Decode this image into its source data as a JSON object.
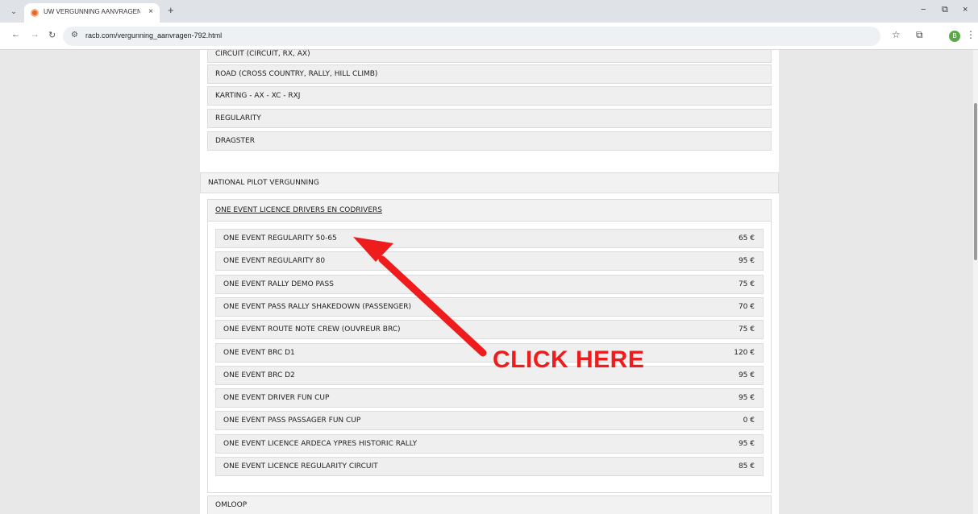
{
  "browser": {
    "tab_title": "UW VERGUNNING AANVRAGEN",
    "tab_close": "×",
    "new_tab": "+",
    "url": "racb.com/vergunning_aanvragen-792.html",
    "minimize": "−",
    "restore": "⧉",
    "close": "×",
    "profile_initial": "B",
    "favicon_color": "#e8622c"
  },
  "page": {
    "categories_top": [
      "CIRCUIT (CIRCUIT, RX, AX)",
      "ROAD (CROSS COUNTRY, RALLY, HILL CLIMB)",
      "KARTING - AX - XC - RXJ",
      "REGULARITY",
      "DRAGSTER"
    ],
    "section_national": "NATIONAL PILOT VERGUNNING",
    "subsection": "ONE EVENT LICENCE DRIVERS EN CODRIVERS",
    "licences": [
      {
        "name": "ONE EVENT REGULARITY 50-65",
        "price": "65 €"
      },
      {
        "name": "ONE EVENT REGULARITY 80",
        "price": "95 €"
      },
      {
        "name": "ONE EVENT RALLY DEMO PASS",
        "price": "75 €"
      },
      {
        "name": "ONE EVENT PASS RALLY SHAKEDOWN (PASSENGER)",
        "price": "70 €"
      },
      {
        "name": "ONE EVENT ROUTE NOTE CREW (OUVREUR BRC)",
        "price": "75 €"
      },
      {
        "name": "ONE EVENT BRC D1",
        "price": "120 €"
      },
      {
        "name": "ONE EVENT BRC D2",
        "price": "95 €"
      },
      {
        "name": "ONE EVENT DRIVER FUN CUP",
        "price": "95 €"
      },
      {
        "name": "ONE EVENT PASS PASSAGER FUN CUP",
        "price": "0 €"
      },
      {
        "name": "ONE EVENT LICENCE ARDECA YPRES HISTORIC RALLY",
        "price": "95 €"
      },
      {
        "name": "ONE EVENT LICENCE REGULARITY CIRCUIT",
        "price": "85 €"
      }
    ],
    "section_omloop": "OMLOOP"
  },
  "annotation": {
    "label": "CLICK HERE",
    "color": "#ee1c1c"
  }
}
